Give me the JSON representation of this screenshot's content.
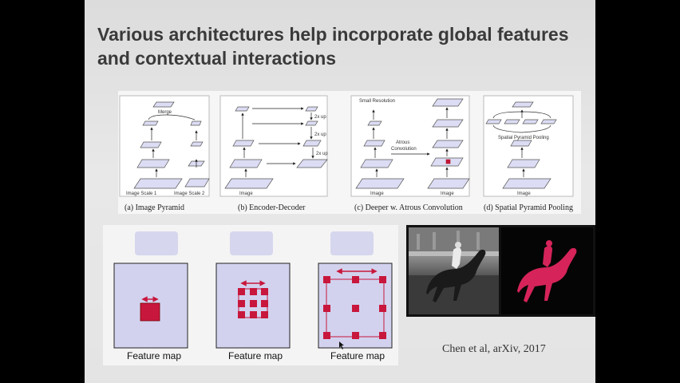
{
  "slide": {
    "title": "Various architectures help incorporate global features and contextual interactions",
    "citation": "Chen et al, arXiv, 2017"
  },
  "figure_top": {
    "panels": [
      {
        "caption": "(a) Image Pyramid",
        "labels": [
          "Merge",
          "Image Scale 1",
          "Image Scale 2"
        ]
      },
      {
        "caption": "(b) Encoder-Decoder",
        "labels": [
          "2x up",
          "2x up",
          "2x up",
          "Image"
        ]
      },
      {
        "caption": "(c) Deeper w. Atrous Convolution",
        "labels": [
          "Small Resolution",
          "Atrous",
          "Convolution",
          "Image"
        ]
      },
      {
        "caption": "(d) Spatial Pyramid Pooling",
        "labels": [
          "Spatial Pyramid Pooling",
          "Image"
        ]
      }
    ]
  },
  "figure_bottom": {
    "label": "Feature map"
  },
  "colors": {
    "layer_fill": "#dcdcf4",
    "feature_map_fill": "#d2d2ee",
    "kernel_fill": "#c8173c",
    "segmentation_fill": "#d6245a"
  }
}
